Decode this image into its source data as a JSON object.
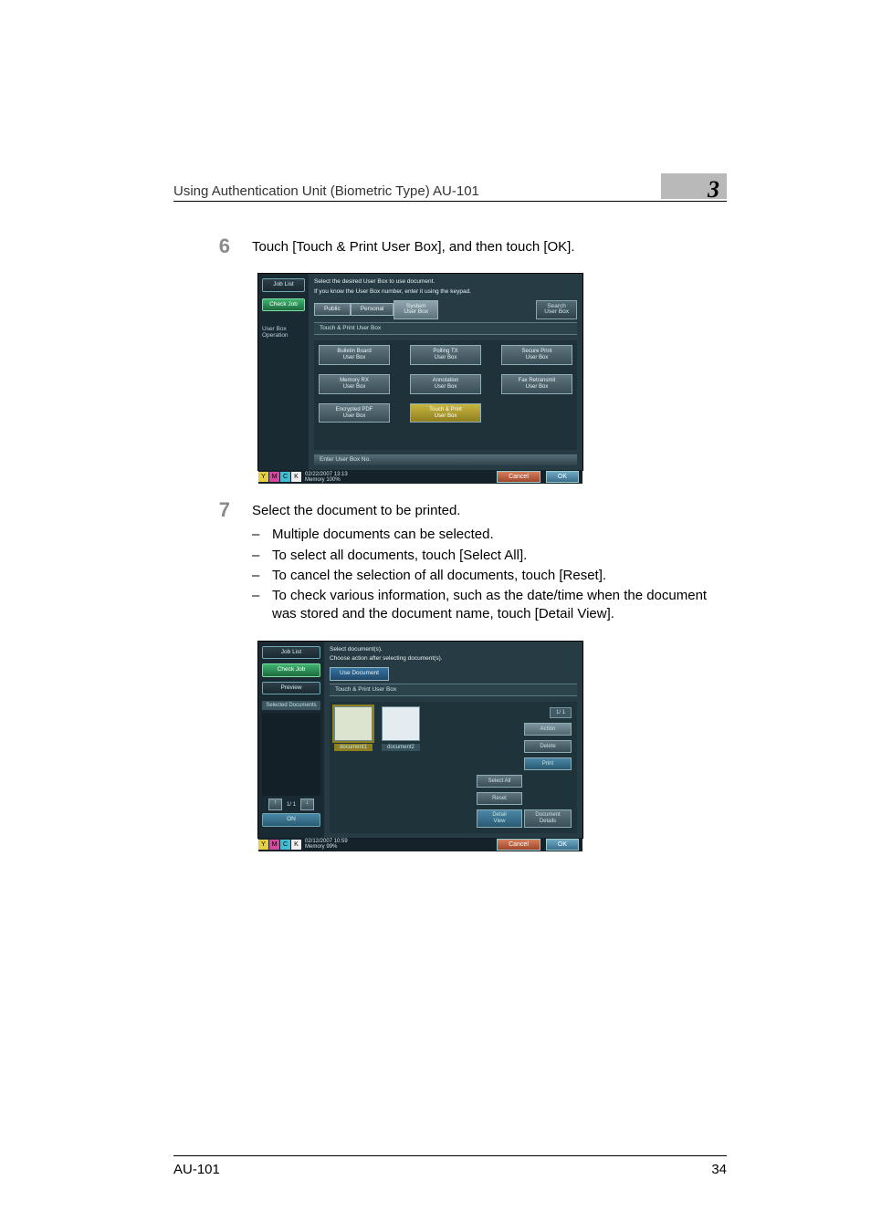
{
  "header": {
    "running_head": "Using Authentication Unit (Biometric Type) AU-101",
    "chapter_number": "3"
  },
  "steps": {
    "s6": {
      "num": "6",
      "text": "Touch [Touch & Print User Box], and then touch [OK]."
    },
    "s7": {
      "num": "7",
      "text": "Select the document to be printed.",
      "bullets": [
        "Multiple documents can be selected.",
        "To select all documents, touch [Select All].",
        "To cancel the selection of all documents, touch [Reset].",
        "To check various information, such as the date/time when the document was stored and the document name, touch [Detail View]."
      ]
    }
  },
  "scr1": {
    "job_list": "Job List",
    "check_job": "Check Job",
    "side_label": "User Box\nOperation",
    "msg1": "Select the desired User Box to use document.",
    "msg2": "If you know the User Box number, enter it using the keypad.",
    "tab_public": "Public",
    "tab_personal": "Personal",
    "tab_system": "System\nUser Box",
    "search": "Search\nUser Box",
    "title_bar": "Touch & Print User Box",
    "btns": {
      "bulletin": "Bulletin Board\nUser Box",
      "polling": "Polling TX\nUser Box",
      "secure": "Secure Print\nUser Box",
      "memory": "Memory RX\nUser Box",
      "annotation": "Annotation\nUser Box",
      "fax_retx": "Fax Retransmit\nUser Box",
      "encrypted": "Encrypted PDF\nUser Box",
      "touch_print": "Touch & Print\nUser Box"
    },
    "enter_box": "Enter User Box No.",
    "timestamp": "02/22/2007   13:13",
    "memory": "Memory        100%",
    "cancel": "Cancel",
    "ok": "OK"
  },
  "scr2": {
    "job_list": "Job List",
    "check_job": "Check Job",
    "preview": "Preview",
    "selected_docs": "Selected Documents",
    "msg1": "Select document(s).",
    "msg2": "Choose action after selecting document(s).",
    "tab_use": "Use Document",
    "title_bar": "Touch & Print User Box",
    "doc1": "document1",
    "doc2": "document2",
    "page": "1/ 1",
    "action": "Action",
    "delete": "Delete",
    "print": "Print",
    "select_all": "Select All",
    "reset": "Reset",
    "detail_view": "Detail\nView",
    "doc_details": "Document\nDetails",
    "page_small": "1/ 1",
    "timestamp": "02/12/2007   10:59",
    "memory": "Memory         99%",
    "cancel": "Cancel",
    "ok": "OK",
    "on": "ON"
  },
  "footer": {
    "left": "AU-101",
    "right": "34"
  }
}
